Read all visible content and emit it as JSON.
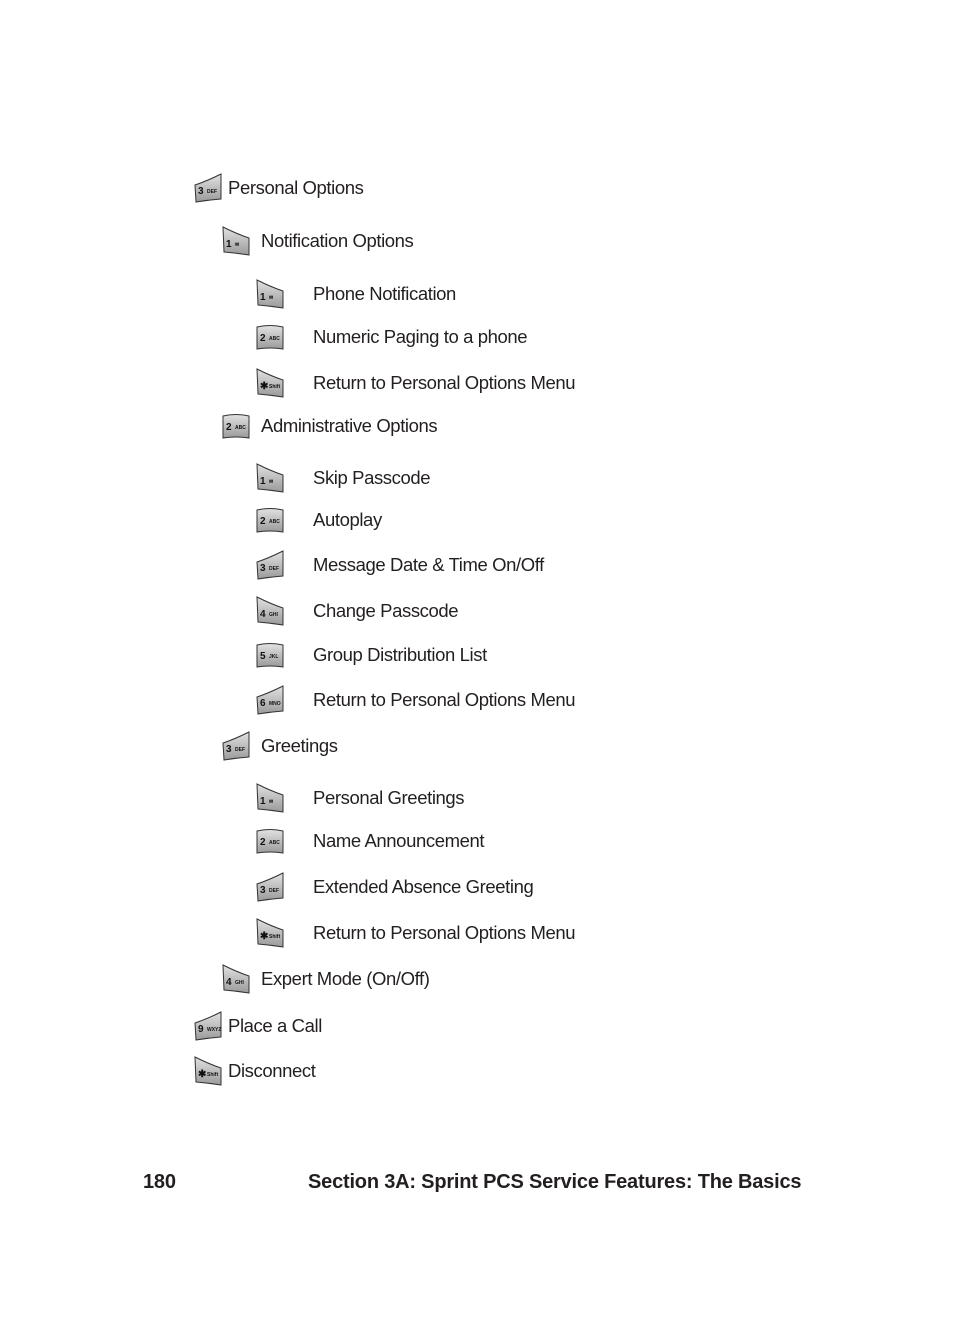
{
  "menu": [
    {
      "key": "3",
      "letters": "DEF",
      "shape": "right-up",
      "label": "Personal Options",
      "level": 0
    },
    {
      "key": "1",
      "letters": "✉",
      "shape": "left-up",
      "label": "Notification Options",
      "level": 1
    },
    {
      "key": "1",
      "letters": "✉",
      "shape": "left-up",
      "label": "Phone Notification",
      "level": 2
    },
    {
      "key": "2",
      "letters": "ABC",
      "shape": "flat",
      "label": "Numeric Paging to a phone",
      "level": 2
    },
    {
      "key": "✱",
      "letters": "Shift",
      "shape": "left-up",
      "label": "Return to Personal Options Menu",
      "level": 2
    },
    {
      "key": "2",
      "letters": "ABC",
      "shape": "flat",
      "label": "Administrative Options",
      "level": 1
    },
    {
      "key": "1",
      "letters": "✉",
      "shape": "left-up",
      "label": "Skip Passcode",
      "level": 2
    },
    {
      "key": "2",
      "letters": "ABC",
      "shape": "flat",
      "label": "Autoplay",
      "level": 2
    },
    {
      "key": "3",
      "letters": "DEF",
      "shape": "right-up",
      "label": "Message Date & Time On/Off",
      "level": 2
    },
    {
      "key": "4",
      "letters": "GHI",
      "shape": "left-up",
      "label": "Change Passcode",
      "level": 2
    },
    {
      "key": "5",
      "letters": "JKL",
      "shape": "flat",
      "label": "Group Distribution List",
      "level": 2
    },
    {
      "key": "6",
      "letters": "MNO",
      "shape": "right-up",
      "label": "Return to Personal Options Menu",
      "level": 2
    },
    {
      "key": "3",
      "letters": "DEF",
      "shape": "right-up",
      "label": "Greetings",
      "level": 1
    },
    {
      "key": "1",
      "letters": "✉",
      "shape": "left-up",
      "label": "Personal Greetings",
      "level": 2
    },
    {
      "key": "2",
      "letters": "ABC",
      "shape": "flat",
      "label": "Name Announcement",
      "level": 2
    },
    {
      "key": "3",
      "letters": "DEF",
      "shape": "right-up",
      "label": "Extended Absence Greeting",
      "level": 2
    },
    {
      "key": "✱",
      "letters": "Shift",
      "shape": "left-up",
      "label": "Return to Personal Options Menu",
      "level": 2
    },
    {
      "key": "4",
      "letters": "GHI",
      "shape": "left-up",
      "label": "Expert Mode (On/Off)",
      "level": 1
    },
    {
      "key": "9",
      "letters": "WXYZ",
      "shape": "right-up",
      "label": "Place a Call",
      "level": 0
    },
    {
      "key": "✱",
      "letters": "Shift",
      "shape": "left-up",
      "label": "Disconnect",
      "level": 0
    }
  ],
  "footer": {
    "page_number": "180",
    "section_title": "Section 3A: Sprint PCS Service Features: The Basics"
  }
}
